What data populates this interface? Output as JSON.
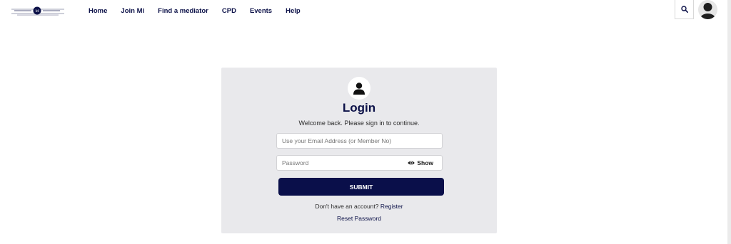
{
  "header": {
    "nav": [
      {
        "label": "Home"
      },
      {
        "label": "Join Mi"
      },
      {
        "label": "Find a mediator"
      },
      {
        "label": "CPD"
      },
      {
        "label": "Events"
      },
      {
        "label": "Help"
      }
    ],
    "search_icon": "search-icon",
    "avatar_icon": "user-avatar-icon"
  },
  "login": {
    "avatar_icon": "user-icon",
    "title": "Login",
    "subtitle": "Welcome back. Please sign in to continue.",
    "email_placeholder": "Use your Email Address (or Member No)",
    "password_placeholder": "Password",
    "show_label": "Show",
    "show_icon": "eye-icon",
    "submit_label": "SUBMIT",
    "no_account_text": "Don't have an account?",
    "register_label": "Register",
    "reset_label": "Reset Password"
  },
  "colors": {
    "brand_navy": "#0a0f4a",
    "card_bg": "#e9e9ec"
  }
}
